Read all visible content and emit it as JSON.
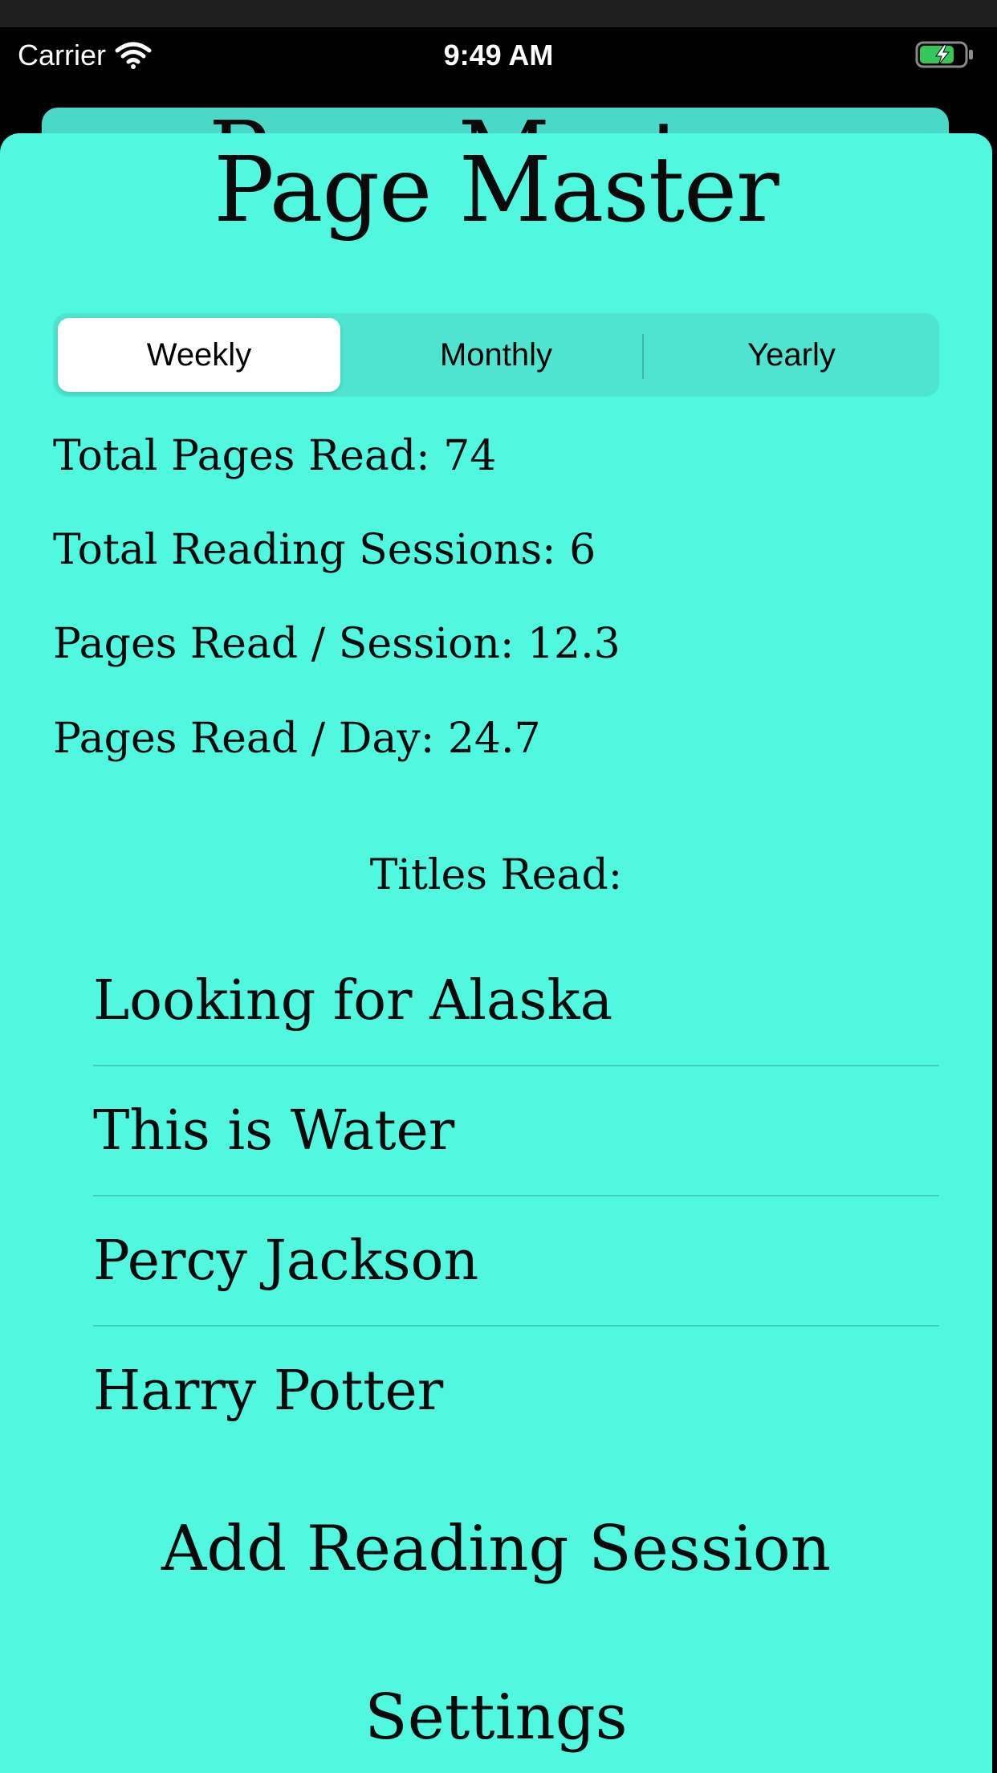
{
  "status_bar": {
    "carrier": "Carrier",
    "time": "9:49 AM"
  },
  "background_title": "Page Master",
  "app": {
    "title": "Page Master"
  },
  "segments": [
    "Weekly",
    "Monthly",
    "Yearly"
  ],
  "selected_segment": "Weekly",
  "stats": {
    "total_pages": "Total Pages Read: 74",
    "total_sessions": "Total Reading Sessions: 6",
    "pages_per_session": "Pages Read  /  Session: 12.3",
    "pages_per_day": "Pages Read  /  Day: 24.7"
  },
  "titles_label": "Titles Read:",
  "titles": [
    "Looking for Alaska",
    "This is Water",
    "Percy Jackson",
    "Harry Potter"
  ],
  "actions": {
    "add_session": "Add Reading Session",
    "settings": "Settings"
  },
  "colors": {
    "sheet": "#50f8e0",
    "segment_track": "#4fe4d0",
    "back_sheet": "#4ad8c8",
    "battery_fill": "#34c759"
  }
}
